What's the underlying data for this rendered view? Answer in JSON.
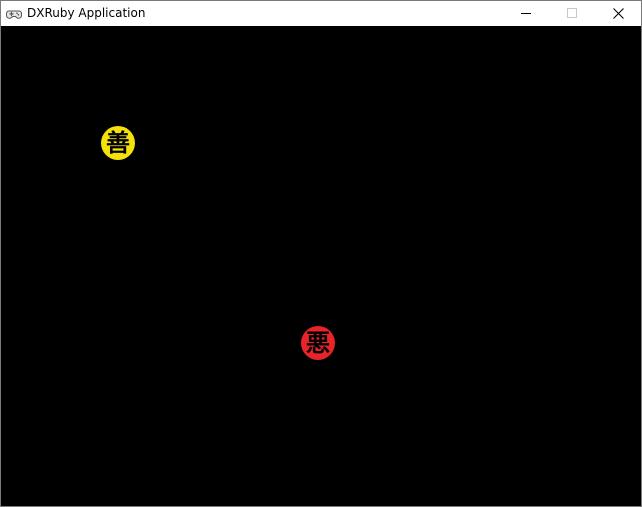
{
  "window": {
    "title": "DXRuby Application"
  },
  "icons": {
    "app": "gamepad-icon",
    "minimize": "minimize-icon",
    "maximize": "maximize-icon",
    "close": "close-icon"
  },
  "game": {
    "background_color": "#000000",
    "sprites": [
      {
        "name": "good",
        "char": "善",
        "color": "#f5e20a"
      },
      {
        "name": "evil",
        "char": "悪",
        "color": "#e8242a"
      }
    ]
  }
}
